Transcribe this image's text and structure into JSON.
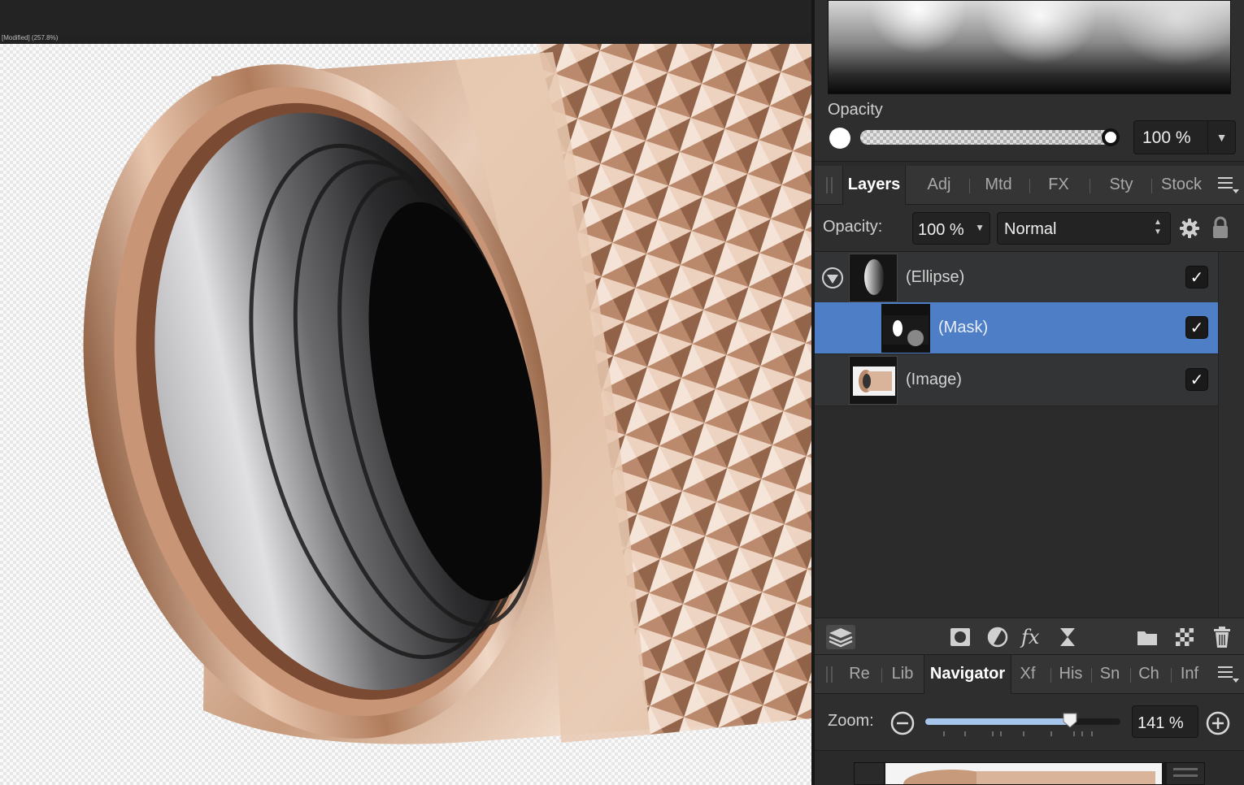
{
  "document": {
    "tab_text": "[Modified] (257.8%)"
  },
  "colors": {
    "accent_selected_row": "#4d7ec6",
    "panel_bg": "#2e2e2e",
    "zoom_fill": "#a7c6ec"
  },
  "brush_panel": {
    "opacity_label": "Opacity",
    "opacity_value": "100 %",
    "opacity_fraction": 1.0,
    "dropdown_arrow": "▼"
  },
  "layers_tabs": {
    "items": [
      {
        "label": "Layers",
        "active": true
      },
      {
        "label": "Adj",
        "active": false
      },
      {
        "label": "Mtd",
        "active": false
      },
      {
        "label": "FX",
        "active": false
      },
      {
        "label": "Sty",
        "active": false
      },
      {
        "label": "Stock",
        "active": false
      }
    ],
    "menu_icon": "hamburger-menu-icon"
  },
  "layer_controls": {
    "opacity_label": "Opacity:",
    "opacity_value": "100 %",
    "opacity_arrow": "▼",
    "blend_mode": "Normal",
    "blend_arrow": "▲▼",
    "gear_icon": "gear-icon",
    "lock_icon": "lock-icon"
  },
  "layers": [
    {
      "name": "(Ellipse)",
      "checked": true,
      "selected": false,
      "child": false,
      "expandable": true,
      "checkmark": "✓"
    },
    {
      "name": "(Mask)",
      "checked": true,
      "selected": true,
      "child": true,
      "expandable": false,
      "checkmark": "✓"
    },
    {
      "name": "(Image)",
      "checked": true,
      "selected": false,
      "child": false,
      "expandable": false,
      "checkmark": "✓"
    }
  ],
  "layers_toolbar": {
    "icons": [
      "layer-stack-icon",
      "mask-layer-icon",
      "adjustment-icon",
      "fx-icon",
      "live-filter-icon",
      "folder-icon",
      "pixel-layer-icon",
      "trash-icon"
    ]
  },
  "nav_tabs": {
    "items": [
      {
        "label": "Re",
        "active": false
      },
      {
        "label": "Lib",
        "active": false
      },
      {
        "label": "Navigator",
        "active": true
      },
      {
        "label": "Xf",
        "active": false
      },
      {
        "label": "His",
        "active": false
      },
      {
        "label": "Sn",
        "active": false
      },
      {
        "label": "Ch",
        "active": false
      },
      {
        "label": "Inf",
        "active": false
      }
    ],
    "menu_icon": "hamburger-menu-icon"
  },
  "zoom": {
    "label": "Zoom:",
    "value": "141 %",
    "slider_fraction": 0.74
  }
}
